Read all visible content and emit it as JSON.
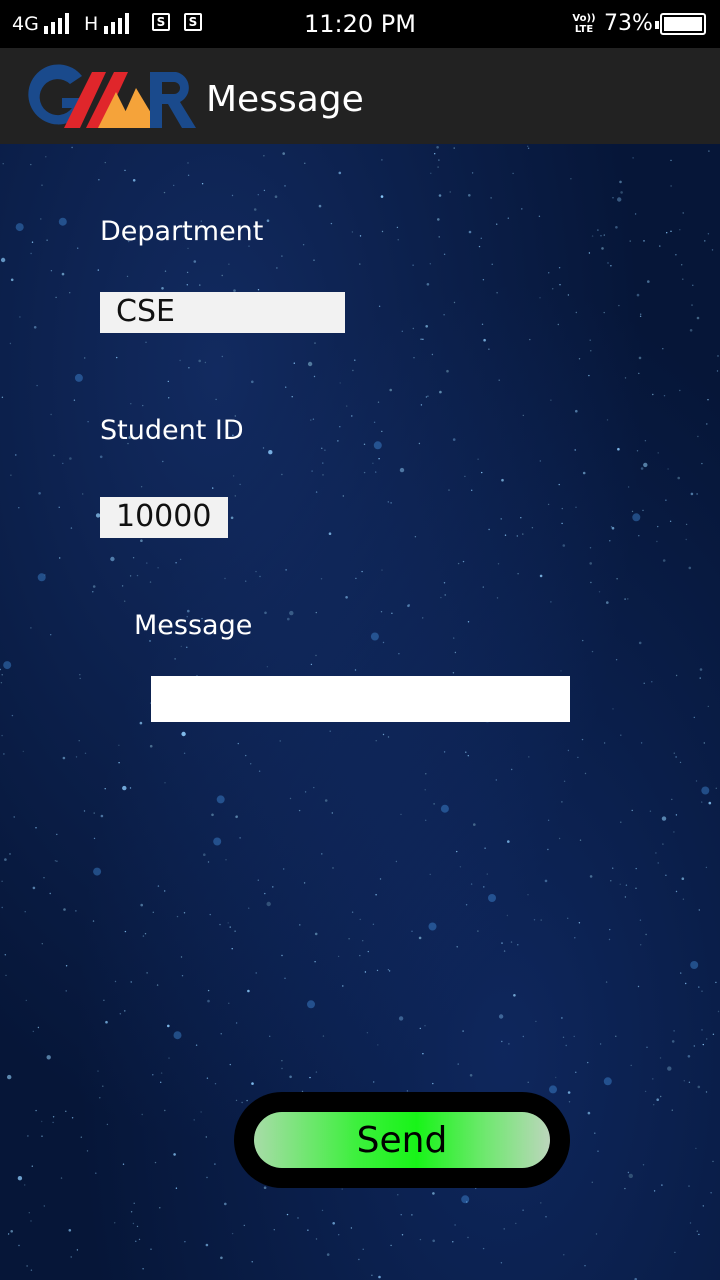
{
  "status_bar": {
    "network": "4G",
    "network2": "H",
    "sim1": "S",
    "sim2": "S",
    "time": "11:20 PM",
    "volte": "Vo)) LTE",
    "battery": "73%"
  },
  "app_bar": {
    "logo_text": "GMR",
    "title": "Message"
  },
  "form": {
    "department_label": "Department",
    "department_value": "CSE",
    "student_id_label": "Student ID",
    "student_id_value": "10000",
    "message_label": "Message",
    "message_value": "",
    "send_label": "Send"
  },
  "colors": {
    "app_bar_bg": "#222222",
    "background": "#061638",
    "send_accent": "#18f418",
    "logo_blue": "#1a4a8c",
    "logo_red": "#e0262b",
    "logo_orange": "#f5a33a"
  }
}
